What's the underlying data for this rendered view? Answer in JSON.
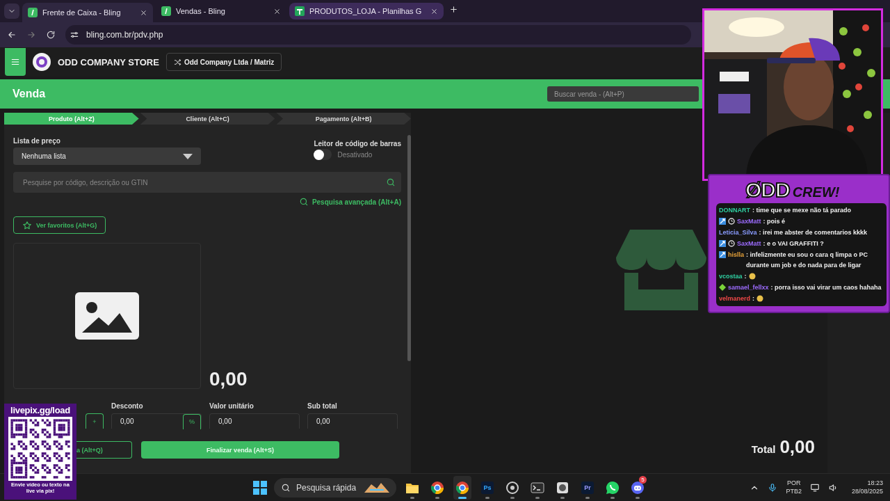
{
  "browser": {
    "tabs": [
      {
        "title": "Frente de Caixa - Bling",
        "kind": "bling",
        "selected": true
      },
      {
        "title": "Vendas - Bling",
        "kind": "bling",
        "selected": false
      },
      {
        "title": "PRODUTOS_LOJA - Planilhas G",
        "kind": "sheets",
        "selected": false
      }
    ],
    "url": "bling.com.br/pdv.php"
  },
  "header": {
    "store_name": "ODD COMPANY STORE",
    "branch": "Odd Company Ltda / Matriz"
  },
  "sale_bar": {
    "title": "Venda",
    "search_placeholder": "Buscar venda - (Alt+P)"
  },
  "steps": [
    {
      "label": "Produto (Alt+Z)",
      "selected": true
    },
    {
      "label": "Cliente (Alt+C)",
      "selected": false
    },
    {
      "label": "Pagamento (Alt+B)",
      "selected": false
    }
  ],
  "form": {
    "price_list_label": "Lista de preço",
    "price_list_value": "Nenhuma lista",
    "barcode_label": "Leitor de código de barras",
    "barcode_on": false,
    "barcode_state": "Desativado",
    "search_placeholder": "Pesquise por código, descrição ou GTIN",
    "advanced_search": "Pesquisa avançada (Alt+A)",
    "favorites": "Ver favoritos (Alt+G)",
    "price": "0,00",
    "quantity_button": "+",
    "fields": [
      {
        "label": "Desconto",
        "value": "0,00",
        "unit_button": "%"
      },
      {
        "label": "Valor unitário",
        "value": "0,00"
      },
      {
        "label": "Sub total",
        "value": "0,00"
      }
    ]
  },
  "actions": {
    "secondary": "a (Alt+Q)",
    "primary": "Finalizar venda (Alt+S)"
  },
  "total": {
    "label": "Total",
    "value": "0,00"
  },
  "chat": {
    "title_left": "ØDD",
    "title_right": "CREW!",
    "messages": [
      {
        "user": "DONNART",
        "color": "#2fd0a2",
        "text": ": time que se mexe não tá parado"
      },
      {
        "user": "SaxMatt",
        "color": "#9d6cff",
        "text": ": pois é",
        "badges": [
          {
            "kind": "sub"
          },
          {
            "kind": "clock"
          }
        ]
      },
      {
        "user": "Leticia_Silva",
        "color": "#8a9cff",
        "text": ": irei me abster de comentarios kkkk"
      },
      {
        "user": "SaxMatt",
        "color": "#9d6cff",
        "text": ": e o VAI GRAFFITI ?",
        "badges": [
          {
            "kind": "sub"
          },
          {
            "kind": "clock"
          }
        ]
      },
      {
        "user": "hislla",
        "color": "#e8a33a",
        "text": ": infelizmente eu sou o cara q limpa o PC durante um job e do nada para de ligar",
        "badges": [
          {
            "kind": "sub"
          }
        ]
      },
      {
        "user": "vcostaa",
        "color": "#2fd0a2",
        "text": ":",
        "emote": true
      },
      {
        "user": "samael_fellxx",
        "color": "#9d6cff",
        "text": ": porra isso vai virar um caos hahaha",
        "badges": [
          {
            "kind": "gem"
          }
        ]
      },
      {
        "user": "velmanerd",
        "color": "#f04848",
        "text": ":",
        "emote": true
      }
    ]
  },
  "livepix": {
    "title": "livepix.gg/load",
    "caption": "Envie vídeo ou texto na live via pix!"
  },
  "taskbar": {
    "search_placeholder": "Pesquisa rápida",
    "apps": [
      {
        "kind": "folder",
        "selected": false
      },
      {
        "kind": "chrome",
        "selected": false
      },
      {
        "kind": "chrome",
        "selected": true
      },
      {
        "kind": "letters",
        "label": "Ps",
        "color": "#31a8ff",
        "selected": false
      },
      {
        "kind": "obs",
        "selected": false
      },
      {
        "kind": "terminal",
        "selected": false
      },
      {
        "kind": "disk",
        "selected": false
      },
      {
        "kind": "letters",
        "label": "Pr",
        "color": "#9999ff",
        "selected": false
      },
      {
        "kind": "whatsapp",
        "selected": false
      },
      {
        "kind": "discord",
        "badge": "5",
        "selected": false
      }
    ],
    "lang": "POR",
    "layout": "PTB2",
    "time": "18:23",
    "date": "28/08/2025"
  }
}
